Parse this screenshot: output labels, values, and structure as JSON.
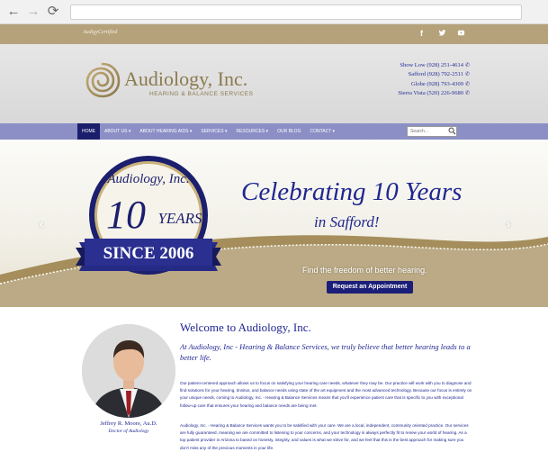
{
  "browser": {
    "back_icon": "back-arrow-icon",
    "forward_icon": "forward-arrow-icon",
    "reload_icon": "reload-icon",
    "url": ""
  },
  "topbar": {
    "brand": "AudigyCertified",
    "social": [
      {
        "icon": "facebook-icon",
        "glyph": "f"
      },
      {
        "icon": "twitter-icon",
        "glyph": "t"
      },
      {
        "icon": "youtube-icon",
        "glyph": "▶"
      }
    ]
  },
  "header": {
    "logo_name": "Audiology, Inc.",
    "logo_tagline": "HEARING & BALANCE SERVICES",
    "offices": [
      {
        "label": "Show Low (928) 251-4614"
      },
      {
        "label": "Safford (928) 792-2511"
      },
      {
        "label": "Globe (928) 793-4309"
      },
      {
        "label": "Sierra Vista (520) 226-9680"
      }
    ]
  },
  "nav": {
    "items": [
      {
        "label": "HOME"
      },
      {
        "label": "ABOUT US ▾"
      },
      {
        "label": "ABOUT HEARING AIDS ▾"
      },
      {
        "label": "SERVICES ▾"
      },
      {
        "label": "RESOURCES ▾"
      },
      {
        "label": "OUR BLOG"
      },
      {
        "label": "CONTACT ▾"
      }
    ],
    "search_placeholder": "Search..."
  },
  "hero": {
    "badge_top": "Audiology, Inc.",
    "badge_number": "10",
    "badge_years": "YEARS",
    "badge_since": "SINCE 2006",
    "title": "Celebrating 10 Years",
    "subtitle": "in Safford!",
    "tagline": "Find the freedom of better hearing.",
    "button": "Request an Appointment"
  },
  "content": {
    "welcome": "Welcome to Audiology, Inc.",
    "intro": "At Audiology, Inc - Hearing & Balance Services, we truly believe that better hearing leads to a better life.",
    "para1": "Our patient-centered approach allows us to focus on satisfying your hearing care needs, whatever they may be. Our practice will work with you to diagnose and find solutions for your hearing, tinnitus, and balance needs using state of the art equipment and the most advanced technology. Because our focus is entirely on your unique needs, coming to Audiology, Inc. - Hearing & Balance Services means that you'll experience patient care that is specific to you with exceptional follow-up care that ensures your hearing and balance needs are being met.",
    "para2": "Audiology, Inc. - Hearing & Balance Services wants you to be satisfied with your care. We are a local, independent, community oriented practice. Our services are fully guaranteed, meaning we are committed to listening to your concerns, and your technology is always perfectly fit to renew your world of hearing. As a top patient provider in Arizona to based on honesty, integrity, and values is what we strive for, and we feel that this is the best approach for making sure you don't miss any of the precious moments in your life.",
    "doctor_name": "Jeffrey R. Moore, Au.D.",
    "doctor_title": "Doctor of Audiology"
  }
}
